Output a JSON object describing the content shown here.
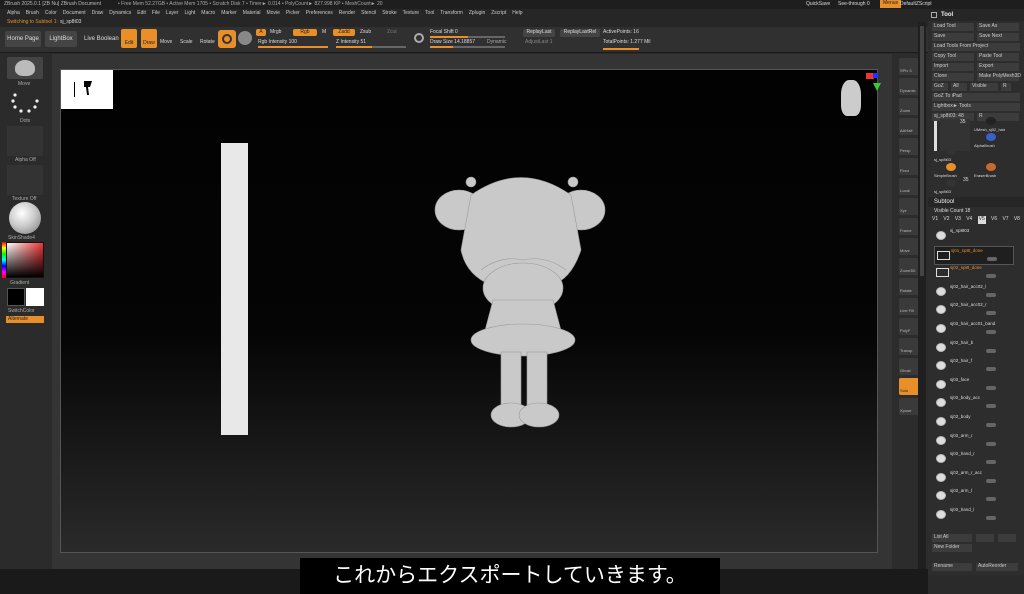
{
  "titlebar": {
    "left": "ZBrush 2025.0.1 [ZB Nu]  ZBrush Document",
    "info": "• Free Mem 52.27GB • Active Mem 1705 • Scratch Disk 7 • Timer► 0.014 • PolyCount► 827.998 KP • MeshCount► 20",
    "quicksave": "QuickSave",
    "seethrough": "See-through  0",
    "menus": "Menus",
    "script": "DefaultZScript"
  },
  "menu": [
    "Alpha",
    "Brush",
    "Color",
    "Document",
    "Draw",
    "Dynamics",
    "Edit",
    "File",
    "Layer",
    "Light",
    "Macro",
    "Marker",
    "Material",
    "Movie",
    "Picker",
    "Preferences",
    "Render",
    "Stencil",
    "Stroke",
    "Texture",
    "Tool",
    "Transform",
    "Zplugin",
    "Zscript",
    "Help"
  ],
  "status": {
    "prefix": "Switching to Subtool 1: ",
    "name": "sj_sp8t03"
  },
  "toolbar": {
    "home": "Home Page",
    "lightbox": "LightBox",
    "live": "Live Boolean",
    "edit": "Edit",
    "draw": "Draw",
    "move": "Move",
    "scale": "Scale",
    "rotate": "Rotate",
    "a": "A",
    "mrgb": "Mrgb",
    "rgb": "Rgb",
    "m": "M",
    "zadd": "Zadd",
    "zsub": "Zsub",
    "zcut": "Zcut",
    "rgbint": "Rgb Intensity 100",
    "zint": "Z Intensity 51",
    "focal": "Focal Shift 0",
    "drawsize": "Draw Size 14.18857",
    "dynamic": "Dynamic",
    "replay": "ReplayLast",
    "replayrel": "ReplayLastRel",
    "adjust": "AdjustLast  1",
    "active": "ActivePoints: 16",
    "total": "TotalPoints: 1.277 Mil"
  },
  "left": {
    "move": "Move",
    "dots": "Dots",
    "alpha": "Alpha Off",
    "texture": "Texture Off",
    "material": "SkinShade4",
    "gradient": "Gradient",
    "switch": "SwitchColor",
    "alternate": "Alternate"
  },
  "rightshelf": [
    "SPix 3",
    "Dynamic",
    "Zoom",
    "AAHalf",
    "Persp",
    "Floor",
    "Local",
    "Xyz",
    "Frame",
    "Move",
    "Zoom3D",
    "Rotate",
    "Line Fill",
    "PolyF",
    "Transp",
    "Ghost",
    "Solo",
    "Xpose"
  ],
  "panel": {
    "title": "Tool",
    "btns": [
      [
        "Load Tool",
        "Save As"
      ],
      [
        "Save",
        "Save Next"
      ],
      [
        "Load Tools From Project",
        ""
      ],
      [
        "Copy Tool",
        "Paste Tool"
      ],
      [
        "Import",
        "Export"
      ],
      [
        "Clone",
        "Make PolyMesh3D"
      ],
      [
        "GoZ",
        "All",
        "Visible",
        "R"
      ],
      [
        "GoZ To iPad",
        ""
      ],
      [
        "Lightbox► Tools",
        ""
      ],
      [
        "sj_sp8t03: 48",
        "R"
      ]
    ],
    "thumbs": [
      "sj_sp8t03",
      "UMesh_sj02_hair",
      "AlphaBrush",
      "SimpleBrush",
      "EraserBrush",
      "sj_sp8t03"
    ],
    "count": "35",
    "count2": "35",
    "subtool": "Subtool",
    "visible": "Visible Count 18",
    "vtabs": [
      "V1",
      "V2",
      "V3",
      "V4",
      "V5",
      "V6",
      "V7",
      "V8"
    ],
    "subtools": [
      "sj_sp8t03",
      "sj01_sp8t_done",
      "sj02_sp8t_done",
      "sj02_hair_acc02_l",
      "sj02_hair_acc02_r",
      "sj02_hair_acc01_band",
      "sj02_hair_b",
      "sj02_hair_f",
      "sj02_face",
      "sj02_body_acc",
      "sj02_body",
      "sj02_arm_r",
      "sj02_hand_r",
      "sj02_arm_r_acc",
      "sj02_arm_l",
      "sj02_hand_l"
    ],
    "listall": "List All",
    "newfolder": "New Folder",
    "rename": "Rename",
    "autoreorder": "AutoReorder"
  },
  "subtitle": "これからエクスポートしていきます。"
}
